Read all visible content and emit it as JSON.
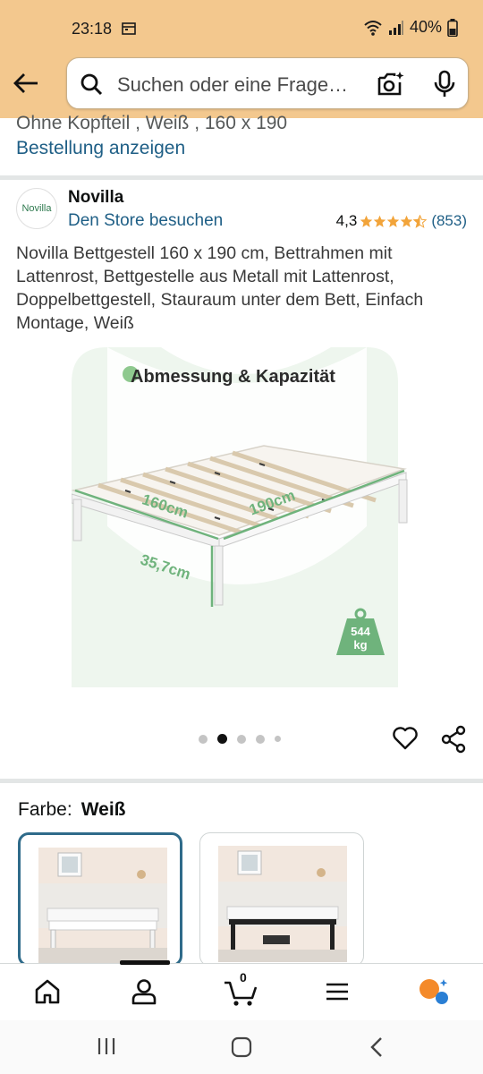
{
  "status_bar": {
    "time": "23:18",
    "battery": "40%"
  },
  "search": {
    "placeholder": "Suchen oder eine Frage…"
  },
  "previous_order": {
    "text": "Ohne Kopfteil , Weiß , 160 x 190",
    "link": "Bestellung anzeigen"
  },
  "seller": {
    "logo_text": "Novilla",
    "name": "Novilla",
    "store_link": "Den Store besuchen",
    "rating": "4,3",
    "stars": 4.3,
    "rating_count": "(853)"
  },
  "product": {
    "title": "Novilla Bettgestell 160 x 190 cm, Bettrahmen mit Lattenrost, Bettgestelle aus Metall mit Lattenrost, Doppelbettgestell, Stauraum unter dem Bett, Einfach Montage, Weiß"
  },
  "image": {
    "caption": "Abmessung & Kapazität",
    "width_label": "160cm",
    "length_label": "190cm",
    "height_label": "35,7cm",
    "capacity_value": "544",
    "capacity_unit": "kg",
    "accent_color": "#6fb37c"
  },
  "carousel": {
    "total": 5,
    "active": 2
  },
  "color_selector": {
    "label": "Farbe:",
    "value": "Weiß"
  },
  "bottom_nav": {
    "cart_count": "0",
    "icons": [
      "home-icon",
      "account-icon",
      "cart-icon",
      "menu-icon",
      "assistant-icon"
    ]
  },
  "colors": {
    "header_bg": "#f3c88e",
    "link": "#1f5f86",
    "star": "#f2a43a",
    "selected_border": "#2f6b8a"
  }
}
